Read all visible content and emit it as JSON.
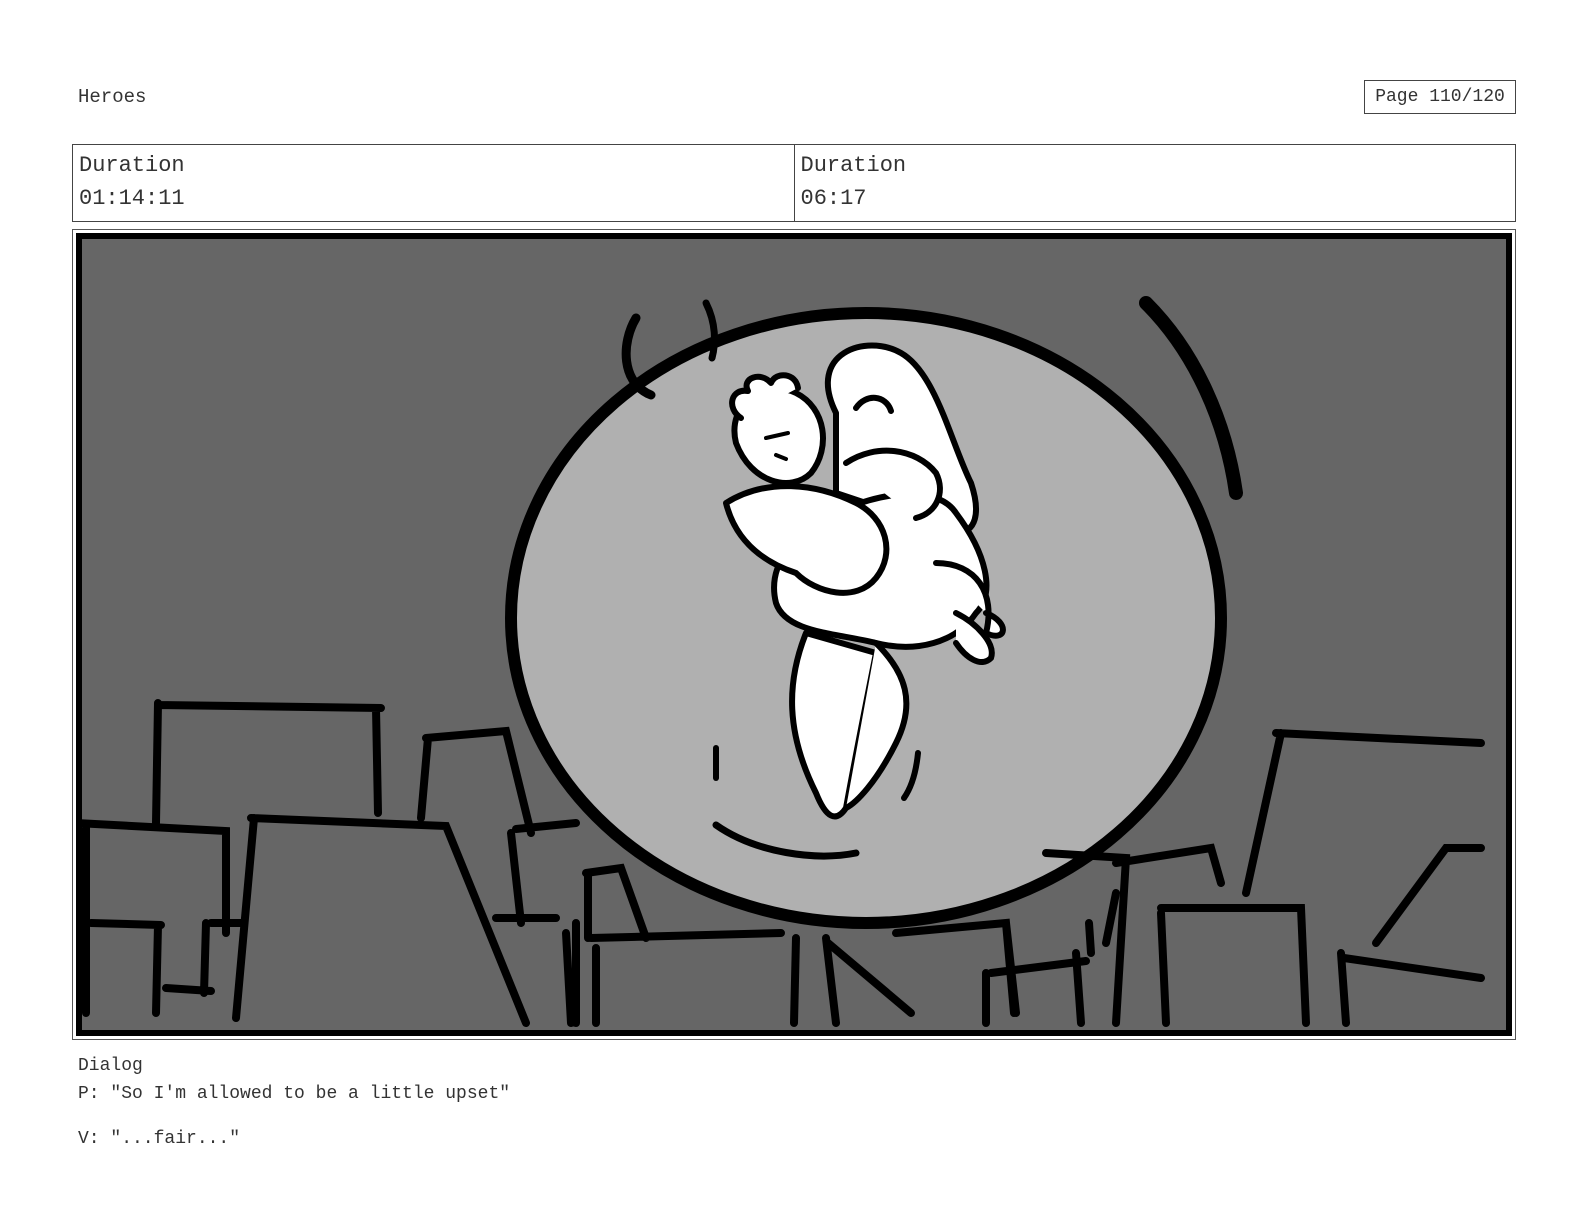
{
  "header": {
    "project_title": "Heroes",
    "page_label": "Page 110/120"
  },
  "durations": [
    {
      "label": "Duration",
      "value": "01:14:11"
    },
    {
      "label": "Duration",
      "value": "06:17"
    }
  ],
  "panel": {
    "colors": {
      "sky": "#666666",
      "moon": "#b0b0b0",
      "ink": "#000000",
      "figure": "#ffffff"
    }
  },
  "dialog": {
    "label": "Dialog",
    "lines": [
      "P: \"So I'm allowed to be a little upset\"",
      "V: \"...fair...\""
    ]
  }
}
